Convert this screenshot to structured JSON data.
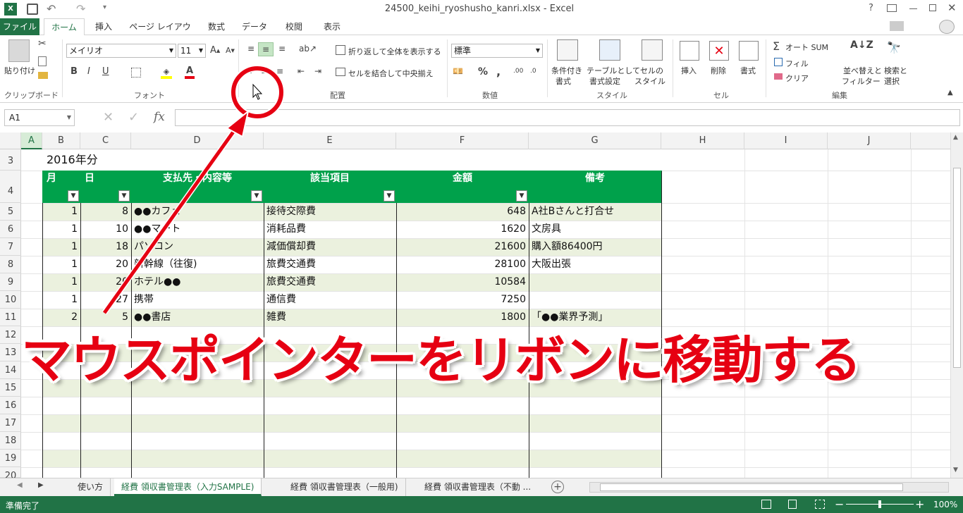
{
  "window": {
    "title": "24500_keihi_ryoshusho_kanri.xlsx - Excel",
    "help": "?",
    "app_icon": "excel-icon"
  },
  "tabs": [
    "ファイル",
    "ホーム",
    "挿入",
    "ページ レイアウト",
    "数式",
    "データ",
    "校閲",
    "表示"
  ],
  "ribbon": {
    "clipboard": {
      "paste": "貼り付け",
      "group": "クリップボード"
    },
    "font": {
      "name": "メイリオ",
      "size": "11",
      "bold": "B",
      "italic": "I",
      "underline": "U",
      "group": "フォント"
    },
    "alignment": {
      "wrap": "折り返して全体を表示する",
      "merge": "セルを結合して中央揃え",
      "group": "配置"
    },
    "number": {
      "format": "標準",
      "percent": "%",
      "comma": ",",
      "group": "数値"
    },
    "styles": {
      "conditional": [
        "条件付き",
        "書式"
      ],
      "table": [
        "テーブルとして",
        "書式設定"
      ],
      "cell": [
        "セルの",
        "スタイル"
      ],
      "group": "スタイル"
    },
    "cells": {
      "insert": "挿入",
      "delete": "削除",
      "format": "書式",
      "group": "セル"
    },
    "editing": {
      "autosum": "オート SUM",
      "fill": "フィル",
      "clear": "クリア",
      "sort": [
        "並べ替えと",
        "フィルター"
      ],
      "find": [
        "検索と",
        "選択"
      ],
      "group": "編集"
    }
  },
  "formula_bar": {
    "name_box": "A1",
    "fx": "fx",
    "value": ""
  },
  "columns": [
    "A",
    "B",
    "C",
    "D",
    "E",
    "F",
    "G",
    "H",
    "I",
    "J"
  ],
  "rows": [
    "3",
    "4",
    "5",
    "6",
    "7",
    "8",
    "9",
    "10",
    "11",
    "12",
    "13",
    "14",
    "15",
    "16",
    "17",
    "18",
    "19",
    "20"
  ],
  "sheet": {
    "year_label": "2016年分",
    "headers": [
      "月",
      "日",
      "支払先・内容等",
      "該当項目",
      "金額",
      "備考"
    ],
    "data": [
      [
        "1",
        "8",
        "●●カフェ",
        "接待交際費",
        "648",
        "A社Bさんと打合せ"
      ],
      [
        "1",
        "10",
        "●●マート",
        "消耗品費",
        "1620",
        "文房具"
      ],
      [
        "1",
        "18",
        "パソコン",
        "減価償却費",
        "21600",
        "購入額86400円"
      ],
      [
        "1",
        "20",
        "新幹線（往復)",
        "旅費交通費",
        "28100",
        "大阪出張"
      ],
      [
        "1",
        "20",
        "ホテル●●",
        "旅費交通費",
        "10584",
        ""
      ],
      [
        "1",
        "27",
        "携帯",
        "通信費",
        "7250",
        ""
      ],
      [
        "2",
        "5",
        "●●書店",
        "雑費",
        "1800",
        "「●●業界予測」"
      ]
    ]
  },
  "sheet_tabs": [
    "使い方",
    "経費 領収書管理表（入力SAMPLE)",
    "経費 領収書管理表（一般用)",
    "経費 領収書管理表（不動 ..."
  ],
  "status": {
    "ready": "準備完了",
    "zoom": "100%"
  },
  "annotation": {
    "caption": "マウスポインターをリボンに移動する"
  },
  "colors": {
    "excel_green": "#217346",
    "header_green": "#00a14b",
    "band_row": "#ebf1de",
    "annotation_red": "#e60012"
  }
}
